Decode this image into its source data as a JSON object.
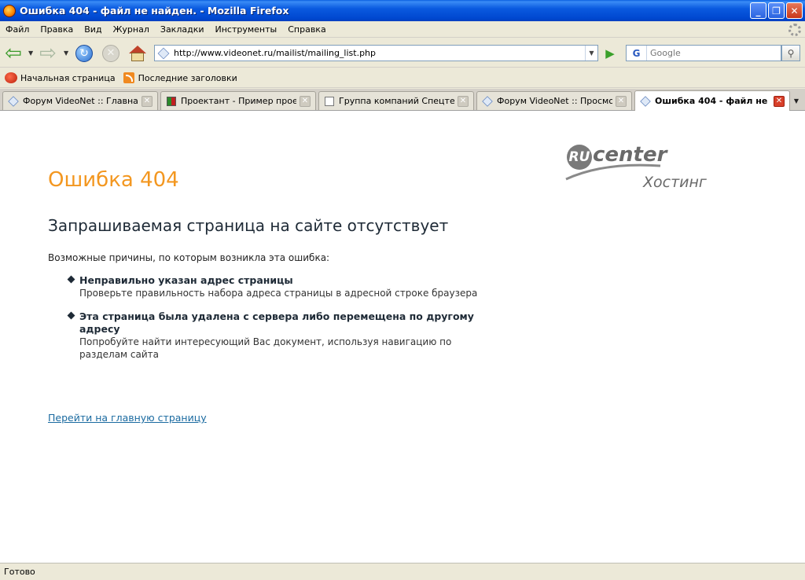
{
  "window": {
    "title": "Ошибка 404 - файл не найден. - Mozilla Firefox",
    "controls": {
      "minimize": "_",
      "maximize": "❐",
      "close": "✕"
    }
  },
  "menu": {
    "items": [
      "Файл",
      "Правка",
      "Вид",
      "Журнал",
      "Закладки",
      "Инструменты",
      "Справка"
    ]
  },
  "navigation": {
    "url": "http://www.videonet.ru/mailist/mailing_list.php",
    "search_placeholder": "Google",
    "search_engine": "G"
  },
  "bookmarks": {
    "items": [
      "Начальная страница",
      "Последние заголовки"
    ]
  },
  "tabs": [
    {
      "label": "Форум VideoNet :: Главная",
      "icon": "videonet-icon"
    },
    {
      "label": "Проектант - Пример прое...",
      "icon": "proektant-icon"
    },
    {
      "label": "Группа компаний Спецтех...",
      "icon": "page-icon"
    },
    {
      "label": "Форум VideoNet :: Просмот...",
      "icon": "videonet-icon"
    },
    {
      "label": "Ошибка 404 - файл не н...",
      "icon": "videonet-icon",
      "active": true
    }
  ],
  "page": {
    "error_title": "Ошибка 404",
    "subtitle": "Запрашиваемая страница на сайте отсутствует",
    "reasons_intro": "Возможные причины, по которым возникла эта ошибка:",
    "reasons": [
      {
        "heading": "Неправильно указан адрес страницы",
        "text": "Проверьте правильность набора адреса страницы в адресной строке браузера"
      },
      {
        "heading": "Эта страница была удалена с сервера либо перемещена по другому адресу",
        "text": "Попробуйте найти интересующий Вас документ, используя навигацию по разделам сайта"
      }
    ],
    "home_link": "Перейти на главную страницу",
    "logo": {
      "ru": "RU",
      "center": "center",
      "hosting": "Хостинг"
    }
  },
  "status": {
    "text": "Готово"
  },
  "colors": {
    "error_title": "#f39720",
    "link": "#1a6aa0",
    "titlebar": "#0a5ae0"
  }
}
